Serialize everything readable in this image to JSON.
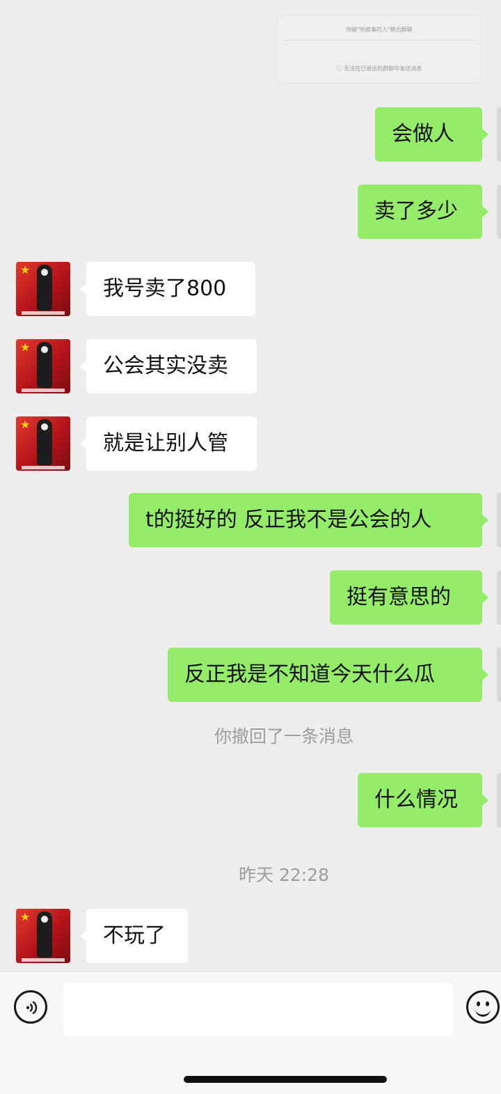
{
  "forwarded_card": {
    "line1": "你被\"听故事的人\"移出群聊",
    "line2": "ⓘ 无法在已退出的群聊中发送消息"
  },
  "messages": [
    {
      "side": "out",
      "text": "会做人"
    },
    {
      "side": "out",
      "text": "卖了多少"
    },
    {
      "side": "in",
      "text": "我号卖了800"
    },
    {
      "side": "in",
      "text": "公会其实没卖"
    },
    {
      "side": "in",
      "text": "就是让别人管"
    },
    {
      "side": "out",
      "text": "t的挺好的 反正我不是公会的人"
    },
    {
      "side": "out",
      "text": "挺有意思的"
    },
    {
      "side": "out",
      "text": "反正我是不知道今天什么瓜"
    },
    {
      "side": "system",
      "text": "你撤回了一条消息"
    },
    {
      "side": "out",
      "text": "什么情况"
    },
    {
      "side": "time",
      "text": "昨天 22:28"
    },
    {
      "side": "in",
      "text": "不玩了"
    }
  ],
  "input": {
    "value": "",
    "placeholder": ""
  },
  "icons": {
    "voice": "voice-icon",
    "emoji": "emoji-icon"
  },
  "colors": {
    "outgoing_bubble": "#95ec69",
    "incoming_bubble": "#ffffff",
    "background": "#ededed"
  }
}
